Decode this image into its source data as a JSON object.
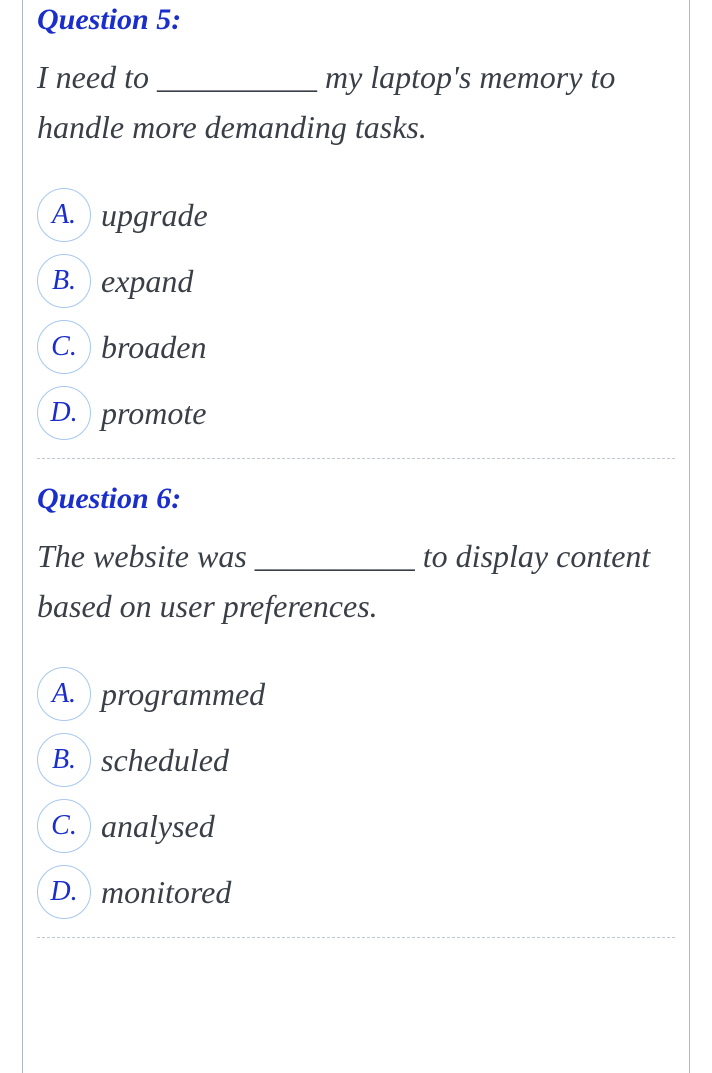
{
  "questions": [
    {
      "title": "Question 5:",
      "text": "I need to __________ my laptop's memory to handle more demanding tasks.",
      "options": [
        {
          "letter": "A.",
          "text": "upgrade"
        },
        {
          "letter": "B.",
          "text": "expand"
        },
        {
          "letter": "C.",
          "text": "broaden"
        },
        {
          "letter": "D.",
          "text": "promote"
        }
      ]
    },
    {
      "title": "Question 6:",
      "text": "The website was __________ to display content based on user preferences.",
      "options": [
        {
          "letter": "A.",
          "text": "programmed"
        },
        {
          "letter": "B.",
          "text": "scheduled"
        },
        {
          "letter": "C.",
          "text": "analysed"
        },
        {
          "letter": "D.",
          "text": "monitored"
        }
      ]
    }
  ]
}
